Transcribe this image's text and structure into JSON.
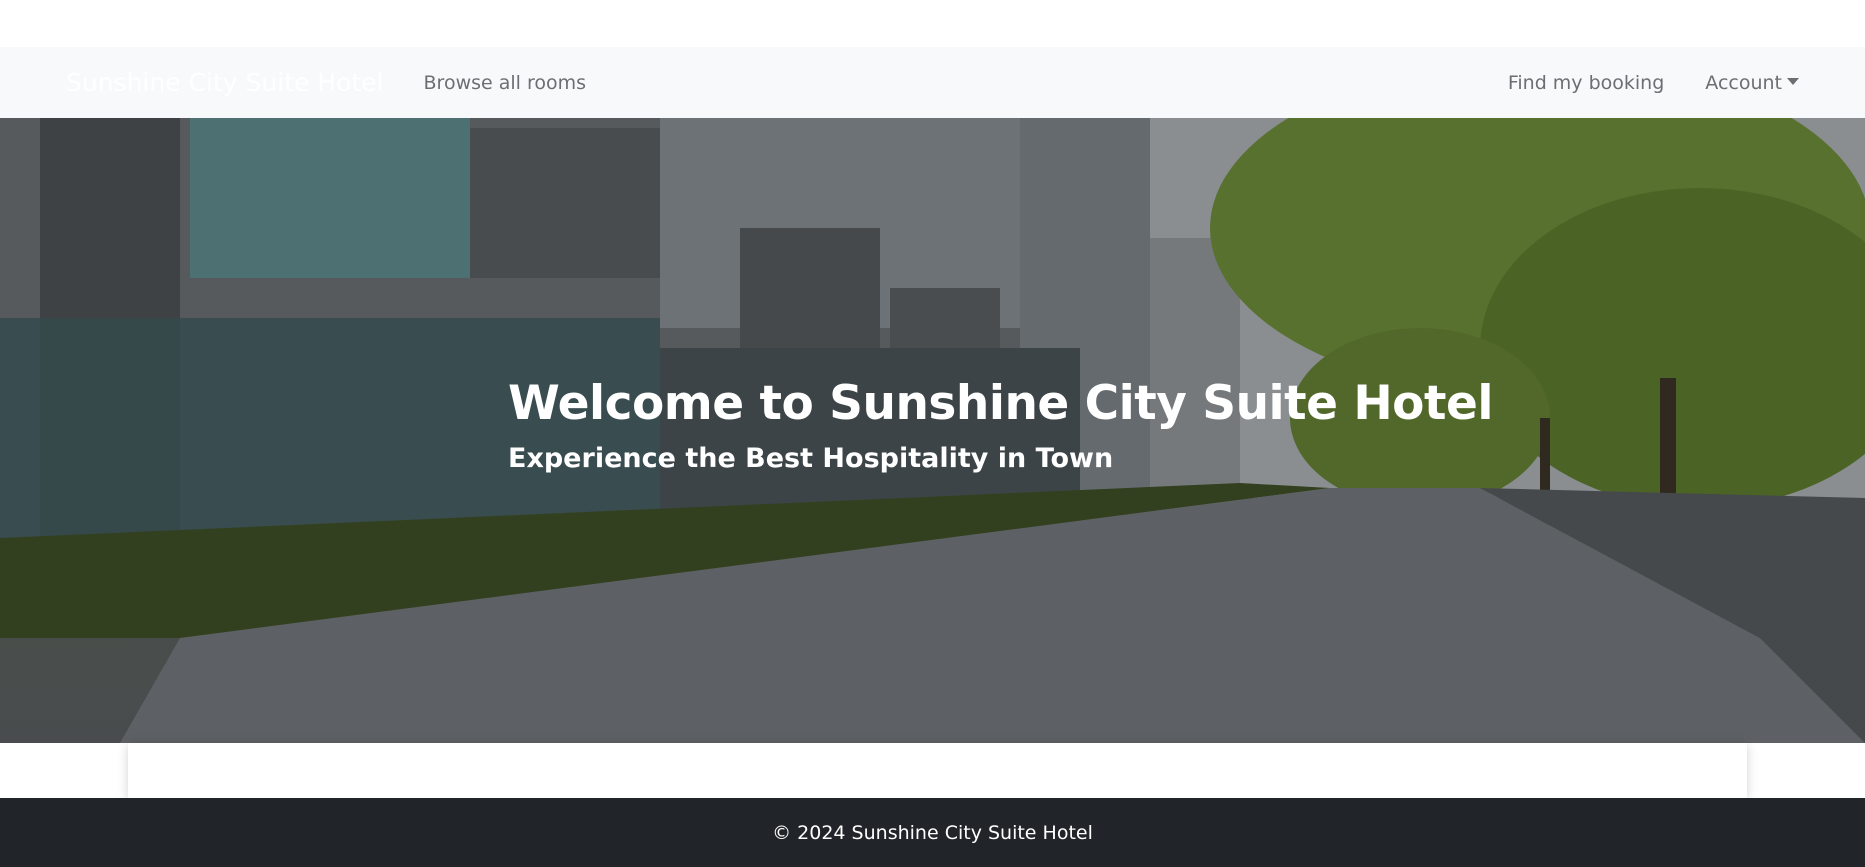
{
  "navbar": {
    "brand": "Sunshine City Suite Hotel",
    "browse_link": "Browse all rooms",
    "find_booking_link": "Find my booking",
    "account_label": "Account"
  },
  "hero": {
    "title": "Welcome to Sunshine City Suite Hotel",
    "subtitle": "Experience the Best Hospitality in Town"
  },
  "footer": {
    "copyright": "© 2024 Sunshine City Suite Hotel"
  },
  "colors": {
    "navbar_bg": "#f8f9fa",
    "nav_link": "#6c6f72",
    "footer_bg": "#212529"
  }
}
